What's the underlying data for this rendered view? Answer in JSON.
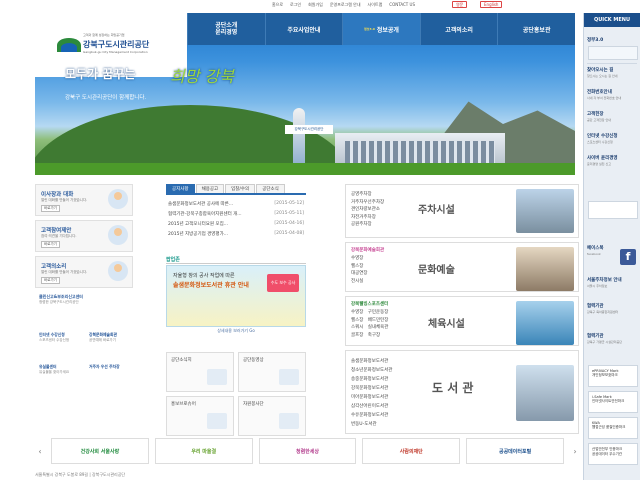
{
  "util": {
    "links": [
      "홈으로",
      "로그인",
      "회원가입",
      "운영프로그램 안내",
      "사이트맵",
      "CONTACT US"
    ],
    "btn1": "영문",
    "btn2": "English"
  },
  "logo": {
    "small": "고객과 함께 성장하는 희망공기업",
    "title": "강북구도시관리공단",
    "sub": "Gangbuk-gu City Management Corporation"
  },
  "nav": {
    "items": [
      "공단소개\n윤리경영",
      "주요사업안내",
      "정보공개",
      "고객의소리",
      "공단홍보관"
    ],
    "badge": "정보3.0"
  },
  "hero": {
    "slogan": "모두가 꿈꾸는",
    "brand": "희망 강북",
    "greeting": "강북구 도시관리공단이 함께합니다.",
    "sign": "강북구도시관리공단"
  },
  "quick": {
    "title": "QUICK MENU",
    "items": [
      {
        "label": "정부3.0",
        "desc": ""
      },
      {
        "label": "찾아오시는 길",
        "desc": "찾으시는 오시는 길 안내"
      },
      {
        "label": "전화번호안내",
        "desc": "사내 각 부서 전화번호 안내"
      },
      {
        "label": "고객헌장",
        "desc": "공단 고객헌장 안내"
      },
      {
        "label": "인터넷 수강신청",
        "desc": "스포츠센터 수강신청"
      },
      {
        "label": "사이버 윤리경영",
        "desc": "윤리경영 실천 신고"
      },
      {
        "label": "페이스북",
        "desc": "facebook"
      },
      {
        "label": "서울주차정보 안내",
        "desc": "서울시 주차정보"
      },
      {
        "label": "협력기관",
        "desc": "강북구 육아종합지원센터"
      },
      {
        "label": "협력기관",
        "desc": "강북구 가평군 시설관리공단"
      }
    ],
    "marks": [
      "ePRIVACY Mark\n개인정보보호마크",
      "i-Safe Mark\n인터넷사이트안전마크",
      "KWA\n웹접근성 품질인증마크",
      "산업안전부 인증마크\n공공데이터 우수기관"
    ]
  },
  "left": {
    "boxes": [
      {
        "title": "이사장과 대화",
        "desc": "열린 대화를 만들어 가겠습니다.",
        "btn": "바로가기"
      },
      {
        "title": "고객참여제안",
        "desc": "참여·의견을 기다립니다.",
        "btn": "바로가기"
      },
      {
        "title": "고객의소리",
        "desc": "열린 대화를 만들어 가겠습니다.",
        "btn": "바로가기"
      }
    ],
    "center": {
      "title": "클린신고&부조리신고센터",
      "desc": "청렴한 강북구도시관리공단"
    },
    "links": [
      {
        "title": "인터넷 수강신청",
        "desc": "스포츠센터 수강신청"
      },
      {
        "title": "강북문화예술회관",
        "desc": "공연예매 바로가기"
      },
      {
        "title": "유실물센터",
        "desc": "유실물을 찾아가세요"
      },
      {
        "title": "거주자 우선 주차장",
        "desc": ""
      }
    ]
  },
  "news": {
    "tabs": [
      "공지사항",
      "채용공고",
      "입찰/수의",
      "공단소식"
    ],
    "rows": [
      {
        "title": "솔샘문화정보도서관 공사에 따른...",
        "date": "[2015-05-12]"
      },
      {
        "title": "협력기관-강북구종합육아지원센터 개...",
        "date": "[2015-05-11]"
      },
      {
        "title": "2015년 고객모니터요원 모집...",
        "date": "[2015-04-16]"
      },
      {
        "title": "2015년 지방공기업 경영평가...",
        "date": "[2015-04-08]"
      }
    ]
  },
  "popup": {
    "head": "팝업존",
    "line1": "자율형 창의 공사 작업에 따른",
    "line2": "솔샘문화정보도서관 휴관 안내",
    "note": "상세내용 보러가기 Go",
    "badge": "수도 보수 공사"
  },
  "shortcuts": {
    "items": [
      "공단소식지",
      "공단동영상",
      "홍보브로슈어",
      "자원봉사단"
    ]
  },
  "facilities": [
    {
      "brand": "강북",
      "title": "주차시설",
      "list": "공영주차장\n거주자우선주차장\n견인차량보관소\n자전거주차장\n공원주차장"
    },
    {
      "brand": "강북문화예술회관",
      "title": "문화예술",
      "list": "수영장\n헬스장\n대공연장\n전시실"
    },
    {
      "brand": "강북웰빙스포츠센터",
      "title": "체육시설",
      "list": "수영장   구민운동장\n헬스장   배드민턴장\n스쿼시   실내체육관\n골프장   축구장"
    },
    {
      "brand": "",
      "title": "도 서 관",
      "list": "솔샘문화정보도서관\n청소년문화정보도서관\n송중문화정보도서관\n강북문화정보도서관\n미아문화정보도서관\n삼각산어린이도서관\n수유문화정보도서관\n번동U-도서관"
    }
  ],
  "banners": [
    "건강사회 서울사랑",
    "우리 마을결",
    "청렴한세상",
    "사람의재단",
    "공공데이터포털"
  ],
  "footer": "서울특별시 강북구 도봉로 89길 | 강북구도시관리공단"
}
